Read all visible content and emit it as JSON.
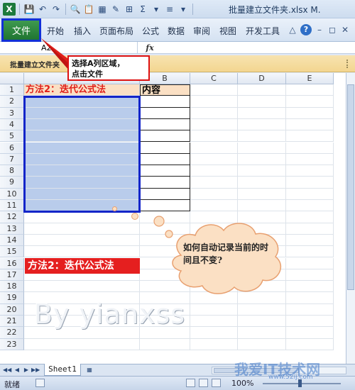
{
  "window": {
    "title": "批量建立文件夹.xlsx M."
  },
  "ribbon": {
    "file_tab": "文件",
    "tabs": [
      "开始",
      "插入",
      "页面布局",
      "公式",
      "数据",
      "审阅",
      "视图",
      "开发工具"
    ]
  },
  "formula_bar": {
    "name_box": "A2",
    "fx_label": "fx",
    "formula": ""
  },
  "document_bar": {
    "label": "批量建立文件夹"
  },
  "grid": {
    "columns": [
      "A",
      "B",
      "C",
      "D",
      "E"
    ],
    "rows": [
      "1",
      "2",
      "3",
      "4",
      "5",
      "6",
      "7",
      "8",
      "9",
      "10",
      "11",
      "12",
      "13",
      "14",
      "15",
      "16",
      "17",
      "18",
      "19",
      "20",
      "21",
      "22",
      "23"
    ],
    "a1": "方法2：迭代公式法",
    "b1": "内容",
    "a15": "方法2：迭代公式法"
  },
  "callout": {
    "line1": "选择A列区域，",
    "line2": "点击文件"
  },
  "cloud": {
    "text": "如何自动记录当前的时间且不变?"
  },
  "watermark": {
    "text": "By yianxss"
  },
  "sheet_tabs": {
    "active": "Sheet1"
  },
  "status_bar": {
    "ready": "就绪",
    "zoom": "100%"
  },
  "site_watermark": {
    "name": "我爱IT技术网",
    "url": "www.52ij.com"
  },
  "colors": {
    "file_tab": "#1f7531",
    "selection": "#b9cceb",
    "highlight_frame": "#1325c9",
    "red_label": "#e51f1f"
  }
}
